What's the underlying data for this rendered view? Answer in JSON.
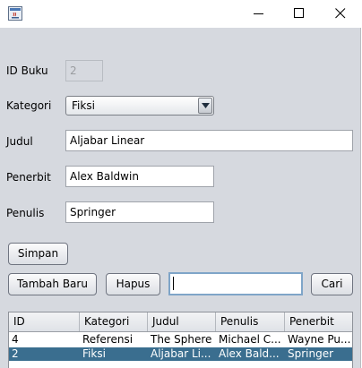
{
  "window": {
    "controls": {
      "minimize": "minimize-icon",
      "maximize": "maximize-icon",
      "close": "close-icon"
    },
    "icon": "java-app-icon"
  },
  "form": {
    "id_label": "ID Buku",
    "id_value": "2",
    "kategori_label": "Kategori",
    "kategori_value": "Fiksi",
    "judul_label": "Judul",
    "judul_value": "Aljabar Linear",
    "penerbit_label": "Penerbit",
    "penerbit_value": "Alex Baldwin",
    "penulis_label": "Penulis",
    "penulis_value": "Springer"
  },
  "buttons": {
    "simpan": "Simpan",
    "tambah_baru": "Tambah Baru",
    "hapus": "Hapus",
    "cari": "Cari"
  },
  "search": {
    "value": ""
  },
  "table": {
    "columns": [
      "ID",
      "Kategori",
      "Judul",
      "Penulis",
      "Penerbit"
    ],
    "rows": [
      [
        "4",
        "Referensi",
        "The Sphere",
        "Michael C...",
        "Wayne Pu..."
      ],
      [
        "2",
        "Fiksi",
        "Aljabar Li...",
        "Alex Bald...",
        "Springer"
      ]
    ],
    "selected_row": 1
  },
  "colors": {
    "selection": "#3a6e8f",
    "background": "#d6d9df"
  }
}
